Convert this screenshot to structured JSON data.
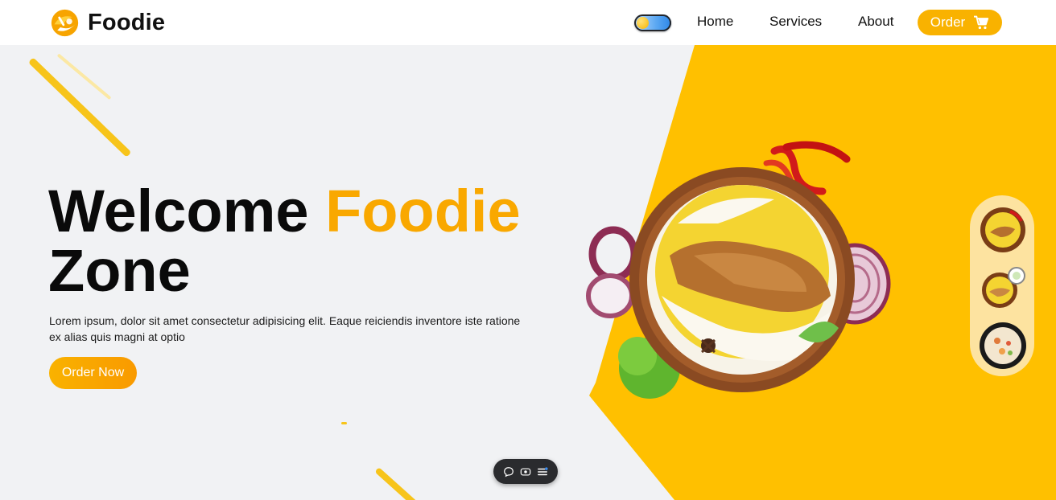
{
  "brand": {
    "name": "Foodie"
  },
  "nav": {
    "items": [
      {
        "label": "Home"
      },
      {
        "label": "Services"
      },
      {
        "label": "About"
      }
    ],
    "order_label": "Order"
  },
  "hero": {
    "title_part1": "Welcome",
    "title_accent": "Foodie",
    "title_part2": "Zone",
    "description": "Lorem ipsum, dolor sit amet consectetur adipisicing elit. Eaque reiciendis inventore iste ratione ex alias quis magni at optio",
    "cta_label": "Order Now"
  },
  "theme": {
    "accent": "#f9b200",
    "panel": "#ffc000",
    "background": "#f1f2f4"
  },
  "toolbar": {
    "icons": [
      "chat-icon",
      "screen-record-icon",
      "menu-icon"
    ]
  }
}
